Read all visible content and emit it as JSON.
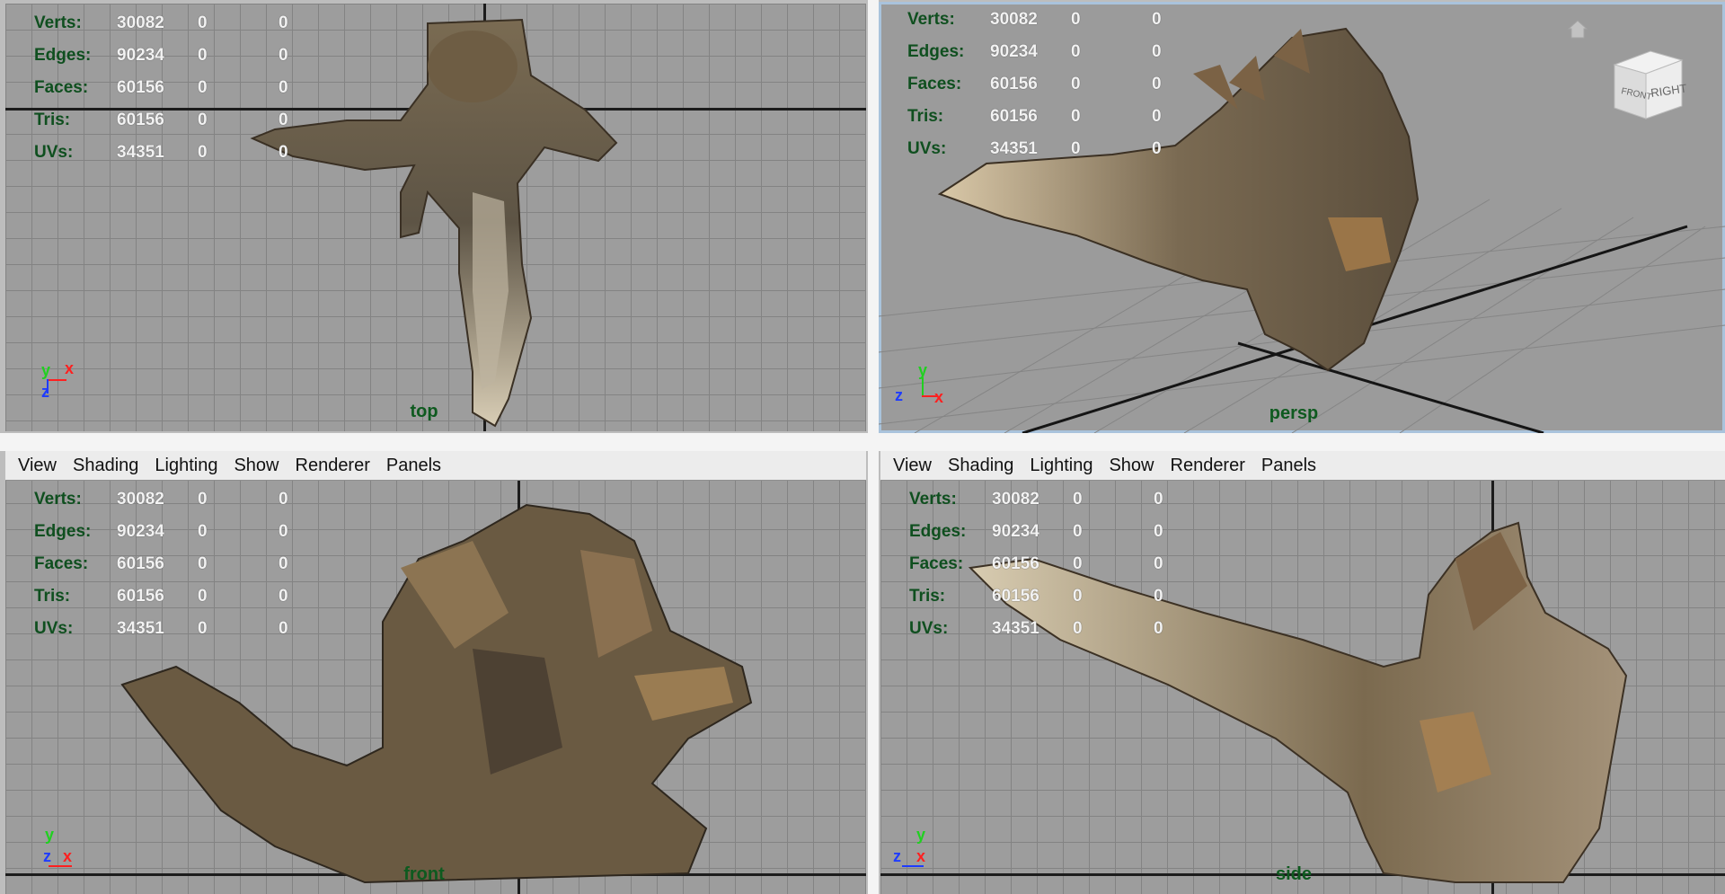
{
  "viewports": [
    {
      "id": "top",
      "camera": "top",
      "stats": [
        {
          "label": "Verts:",
          "value": "30082",
          "a": "0",
          "b": "0"
        },
        {
          "label": "Edges:",
          "value": "90234",
          "a": "0",
          "b": "0"
        },
        {
          "label": "Faces:",
          "value": "60156",
          "a": "0",
          "b": "0"
        },
        {
          "label": "Tris:",
          "value": "60156",
          "a": "0",
          "b": "0"
        },
        {
          "label": "UVs:",
          "value": "34351",
          "a": "0",
          "b": "0"
        }
      ],
      "axes": [
        "y",
        "x",
        "z"
      ]
    },
    {
      "id": "persp",
      "camera": "persp",
      "stats": [
        {
          "label": "Verts:",
          "value": "30082",
          "a": "0",
          "b": "0"
        },
        {
          "label": "Edges:",
          "value": "90234",
          "a": "0",
          "b": "0"
        },
        {
          "label": "Faces:",
          "value": "60156",
          "a": "0",
          "b": "0"
        },
        {
          "label": "Tris:",
          "value": "60156",
          "a": "0",
          "b": "0"
        },
        {
          "label": "UVs:",
          "value": "34351",
          "a": "0",
          "b": "0"
        }
      ],
      "axes": [
        "y",
        "z",
        "x"
      ],
      "viewcube": {
        "front": "FRONT",
        "right": "RIGHT"
      }
    },
    {
      "id": "front",
      "camera": "front",
      "stats": [
        {
          "label": "Verts:",
          "value": "30082",
          "a": "0",
          "b": "0"
        },
        {
          "label": "Edges:",
          "value": "90234",
          "a": "0",
          "b": "0"
        },
        {
          "label": "Faces:",
          "value": "60156",
          "a": "0",
          "b": "0"
        },
        {
          "label": "Tris:",
          "value": "60156",
          "a": "0",
          "b": "0"
        },
        {
          "label": "UVs:",
          "value": "34351",
          "a": "0",
          "b": "0"
        }
      ],
      "axes": [
        "y",
        "z",
        "x"
      ]
    },
    {
      "id": "side",
      "camera": "side",
      "stats": [
        {
          "label": "Verts:",
          "value": "30082",
          "a": "0",
          "b": "0"
        },
        {
          "label": "Edges:",
          "value": "90234",
          "a": "0",
          "b": "0"
        },
        {
          "label": "Faces:",
          "value": "60156",
          "a": "0",
          "b": "0"
        },
        {
          "label": "Tris:",
          "value": "60156",
          "a": "0",
          "b": "0"
        },
        {
          "label": "UVs:",
          "value": "34351",
          "a": "0",
          "b": "0"
        }
      ],
      "axes": [
        "y",
        "z",
        "x"
      ]
    }
  ],
  "menu": [
    "View",
    "Shading",
    "Lighting",
    "Show",
    "Renderer",
    "Panels"
  ],
  "colors": {
    "hud_label": "#0f4f1f",
    "axis_x": "#ff2020",
    "axis_y": "#20d020",
    "axis_z": "#1f3cff",
    "grid": "#838383",
    "active_border": "#a9c3dc"
  }
}
